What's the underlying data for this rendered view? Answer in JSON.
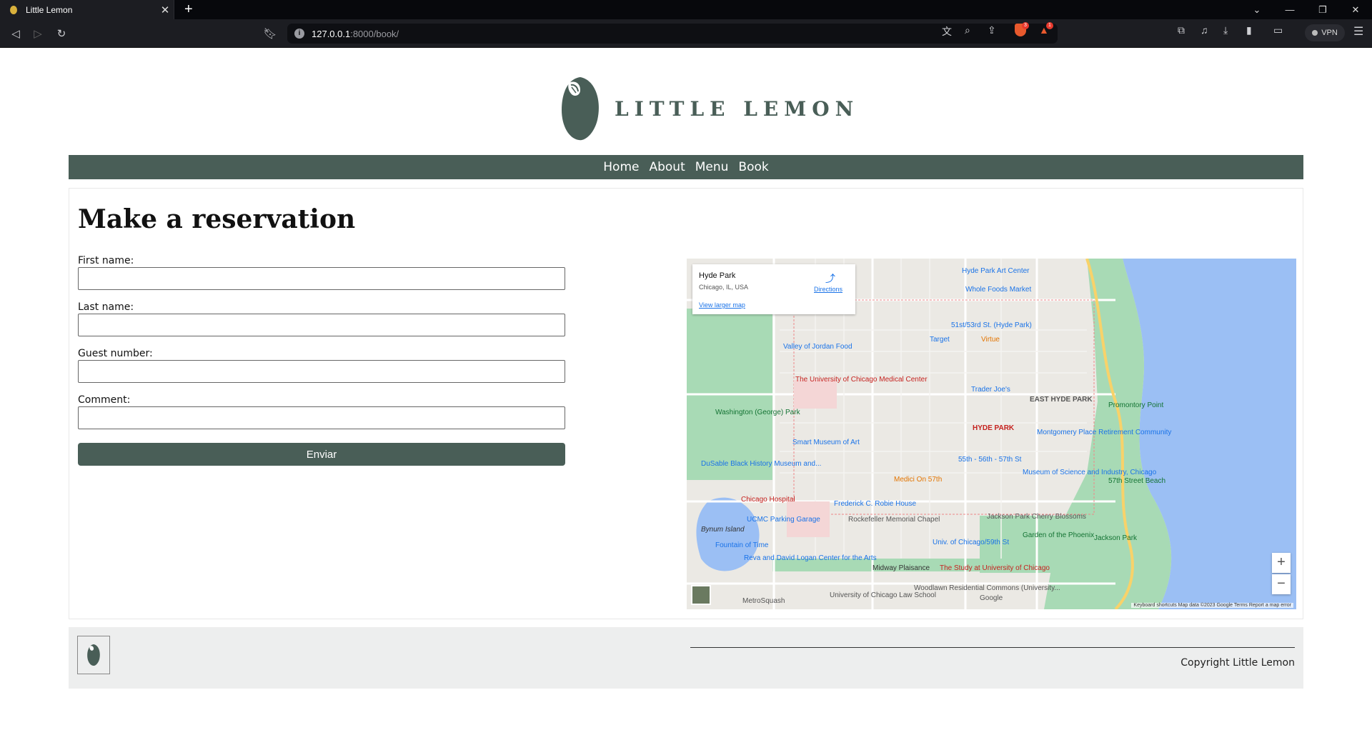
{
  "browser": {
    "tab_title": "Little Lemon",
    "url_host": "127.0.0.1",
    "url_rest": ":8000/book/",
    "vpn_label": "VPN",
    "shield_badge": "3",
    "alert_badge": "1"
  },
  "site": {
    "brand": "LITTLE LEMON",
    "nav": [
      "Home",
      "About",
      "Menu",
      "Book"
    ]
  },
  "reservation": {
    "heading": "Make a reservation",
    "fields": [
      {
        "label": "First name:",
        "value": ""
      },
      {
        "label": "Last name:",
        "value": ""
      },
      {
        "label": "Guest number:",
        "value": ""
      },
      {
        "label": "Comment:",
        "value": ""
      }
    ],
    "submit_label": "Enviar"
  },
  "map": {
    "place_name": "Hyde Park",
    "address": "Chicago, IL, USA",
    "directions_label": "Directions",
    "larger_map_label": "View larger map",
    "zoom_in": "+",
    "zoom_out": "−",
    "attribution": "Keyboard shortcuts   Map data ©2023 Google   Terms   Report a map error",
    "google_label": "Google",
    "labels": [
      {
        "text": "Hyde Park Art Center",
        "color": "#1a73e8"
      },
      {
        "text": "Whole Foods Market",
        "color": "#1a73e8"
      },
      {
        "text": "HYDE PARK",
        "color": "#c5221f"
      },
      {
        "text": "Washington (George) Park",
        "color": "#137333"
      },
      {
        "text": "The University of Chicago Medical Center",
        "color": "#c5221f"
      },
      {
        "text": "Smart Museum of Art",
        "color": "#1a73e8"
      },
      {
        "text": "Valley of Jordan Food",
        "color": "#1a73e8"
      },
      {
        "text": "Target",
        "color": "#1a73e8"
      },
      {
        "text": "Virtue",
        "color": "#e37400"
      },
      {
        "text": "51st/53rd St. (Hyde Park)",
        "color": "#1a73e8"
      },
      {
        "text": "Trader Joe's",
        "color": "#1a73e8"
      },
      {
        "text": "EAST HYDE PARK",
        "color": "#555"
      },
      {
        "text": "Promontory Point",
        "color": "#137333"
      },
      {
        "text": "Montgomery Place Retirement Community",
        "color": "#1a73e8"
      },
      {
        "text": "55th - 56th - 57th St",
        "color": "#1a73e8"
      },
      {
        "text": "Museum of Science and Industry, Chicago",
        "color": "#1a73e8"
      },
      {
        "text": "57th Street Beach",
        "color": "#137333"
      },
      {
        "text": "DuSable Black History Museum and...",
        "color": "#1a73e8"
      },
      {
        "text": "Medici On 57th",
        "color": "#e37400"
      },
      {
        "text": "Chicago Hospital",
        "color": "#c5221f"
      },
      {
        "text": "Frederick C. Robie House",
        "color": "#1a73e8"
      },
      {
        "text": "Rockefeller Memorial Chapel",
        "color": "#555"
      },
      {
        "text": "Jackson Park Cherry Blossoms",
        "color": "#555"
      },
      {
        "text": "UCMC Parking Garage",
        "color": "#1a73e8"
      },
      {
        "text": "Bynum Island",
        "color": "#333"
      },
      {
        "text": "Fountain of Time",
        "color": "#1a73e8"
      },
      {
        "text": "Garden of the Phoenix",
        "color": "#137333"
      },
      {
        "text": "Jackson Park",
        "color": "#137333"
      },
      {
        "text": "Univ. of Chicago/59th St",
        "color": "#1a73e8"
      },
      {
        "text": "Reva and David Logan Center for the Arts",
        "color": "#1a73e8"
      },
      {
        "text": "Midway Plaisance",
        "color": "#333"
      },
      {
        "text": "The Study at University of Chicago",
        "color": "#c5221f"
      },
      {
        "text": "Woodlawn Residential Commons (University...",
        "color": "#555"
      },
      {
        "text": "University of Chicago Law School",
        "color": "#555"
      },
      {
        "text": "MetroSquash",
        "color": "#555"
      }
    ]
  },
  "footer": {
    "copyright": "Copyright Little Lemon"
  },
  "colors": {
    "brand_green": "#495e57",
    "map_water": "#9bbff4",
    "map_park": "#a8dab5"
  }
}
